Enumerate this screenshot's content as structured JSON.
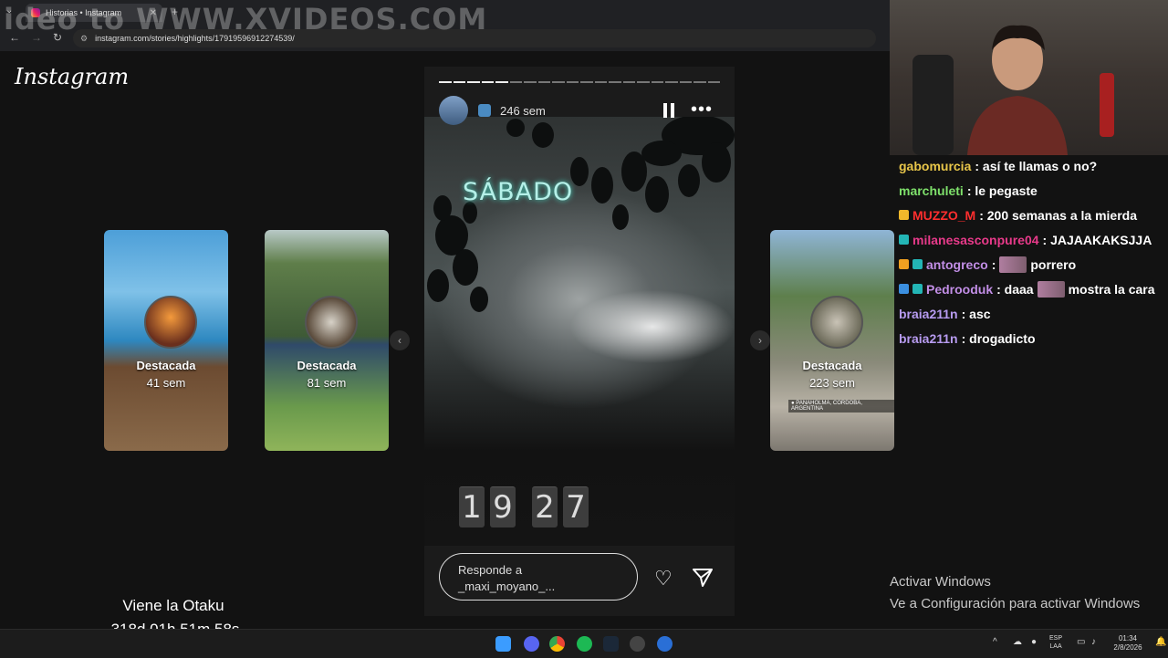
{
  "browser": {
    "tab_title": "Historias • Instagram",
    "url": "instagram.com/stories/highlights/17919596912274539/",
    "watermark": "ideo to WWW.XVIDEOS.COM"
  },
  "instagram": {
    "logo": "Instagram",
    "highlights": [
      {
        "title": "Destacada",
        "age": "41 sem"
      },
      {
        "title": "Destacada",
        "age": "81 sem"
      },
      {
        "title": "Destacada",
        "age": "223 sem",
        "caption": "● PANAHOLMA, CORDOBA, ARGENTINA"
      }
    ],
    "story": {
      "time_ago": "246 sem",
      "progress_total": 20,
      "progress_done": 5,
      "sticker_text": "SÁBADO",
      "clock_digits": [
        "1",
        "9",
        "2",
        "7"
      ],
      "reply_placeholder": "Responde a _maxi_moyano_..."
    }
  },
  "chat": [
    {
      "user": "gabomurcia",
      "color": "#e8c64a",
      "text": ": así te llamas o no?",
      "badges": []
    },
    {
      "user": "marchuleti",
      "color": "#7ee06b",
      "text": ": le pegaste",
      "badges": []
    },
    {
      "user": "MUZZO_M",
      "color": "#ff2e2e",
      "text": ": 200 semanas a la mierda",
      "badges": [
        "#f0b82b"
      ]
    },
    {
      "user": "milanesasconpure04",
      "color": "#e83a8a",
      "text": ": JAJAAKAKSJJA",
      "badges": [
        "#23b5b5"
      ]
    },
    {
      "user": "antogreco",
      "color": "#c28ee6",
      "text": ":",
      "emote": true,
      "text2": "porrero",
      "badges": [
        "#f0a020",
        "#23b5b5"
      ]
    },
    {
      "user": "Pedrooduk",
      "color": "#c28ee6",
      "text": ": daaa",
      "emote": true,
      "text2": "mostra la cara",
      "badges": [
        "#3b8fe0",
        "#23b5b5"
      ]
    },
    {
      "user": "braia211n",
      "color": "#b79bf0",
      "text": ": asc",
      "badges": []
    },
    {
      "user": "braia211n",
      "color": "#b79bf0",
      "text": ": drogadicto",
      "badges": []
    }
  ],
  "windows": {
    "activate_title": "Activar Windows",
    "activate_sub": "Ve a Configuración para activar Windows",
    "lang_1": "ESP",
    "lang_2": "LAA",
    "time": "01:34",
    "date": "2/8/2026"
  },
  "overlay": {
    "title": "Viene la Otaku",
    "countdown": "318d 01h 51m 58s"
  }
}
